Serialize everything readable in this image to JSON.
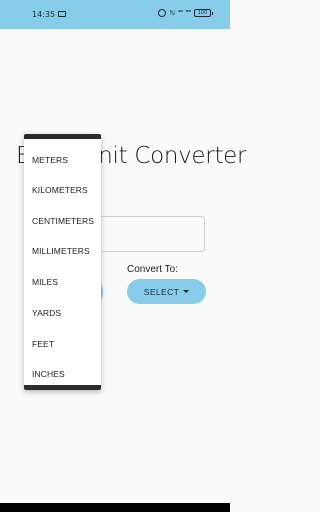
{
  "status_bar": {
    "time": "14:35",
    "mute_symbol": "ℕ",
    "network_tag": "⁴ᴳ",
    "signal_tag": "ᴴᴰ",
    "battery": "100",
    "icons": [
      "message-icon",
      "alarm-icon",
      "mute-icon",
      "signal-icon",
      "battery-icon"
    ]
  },
  "app": {
    "title": "Basic Unit Converter",
    "convert_to_label": "Convert To:",
    "select_label": "SELECT"
  },
  "dropdown": {
    "items": [
      "METERS",
      "KILOMETERS",
      "CENTIMETERS",
      "MILLIMETERS",
      "MILES",
      "YARDS",
      "FEET",
      "INCHES"
    ]
  },
  "colors": {
    "accent": "#87cdea",
    "background": "#fafafa",
    "menu_edge": "#2b2b2b"
  }
}
